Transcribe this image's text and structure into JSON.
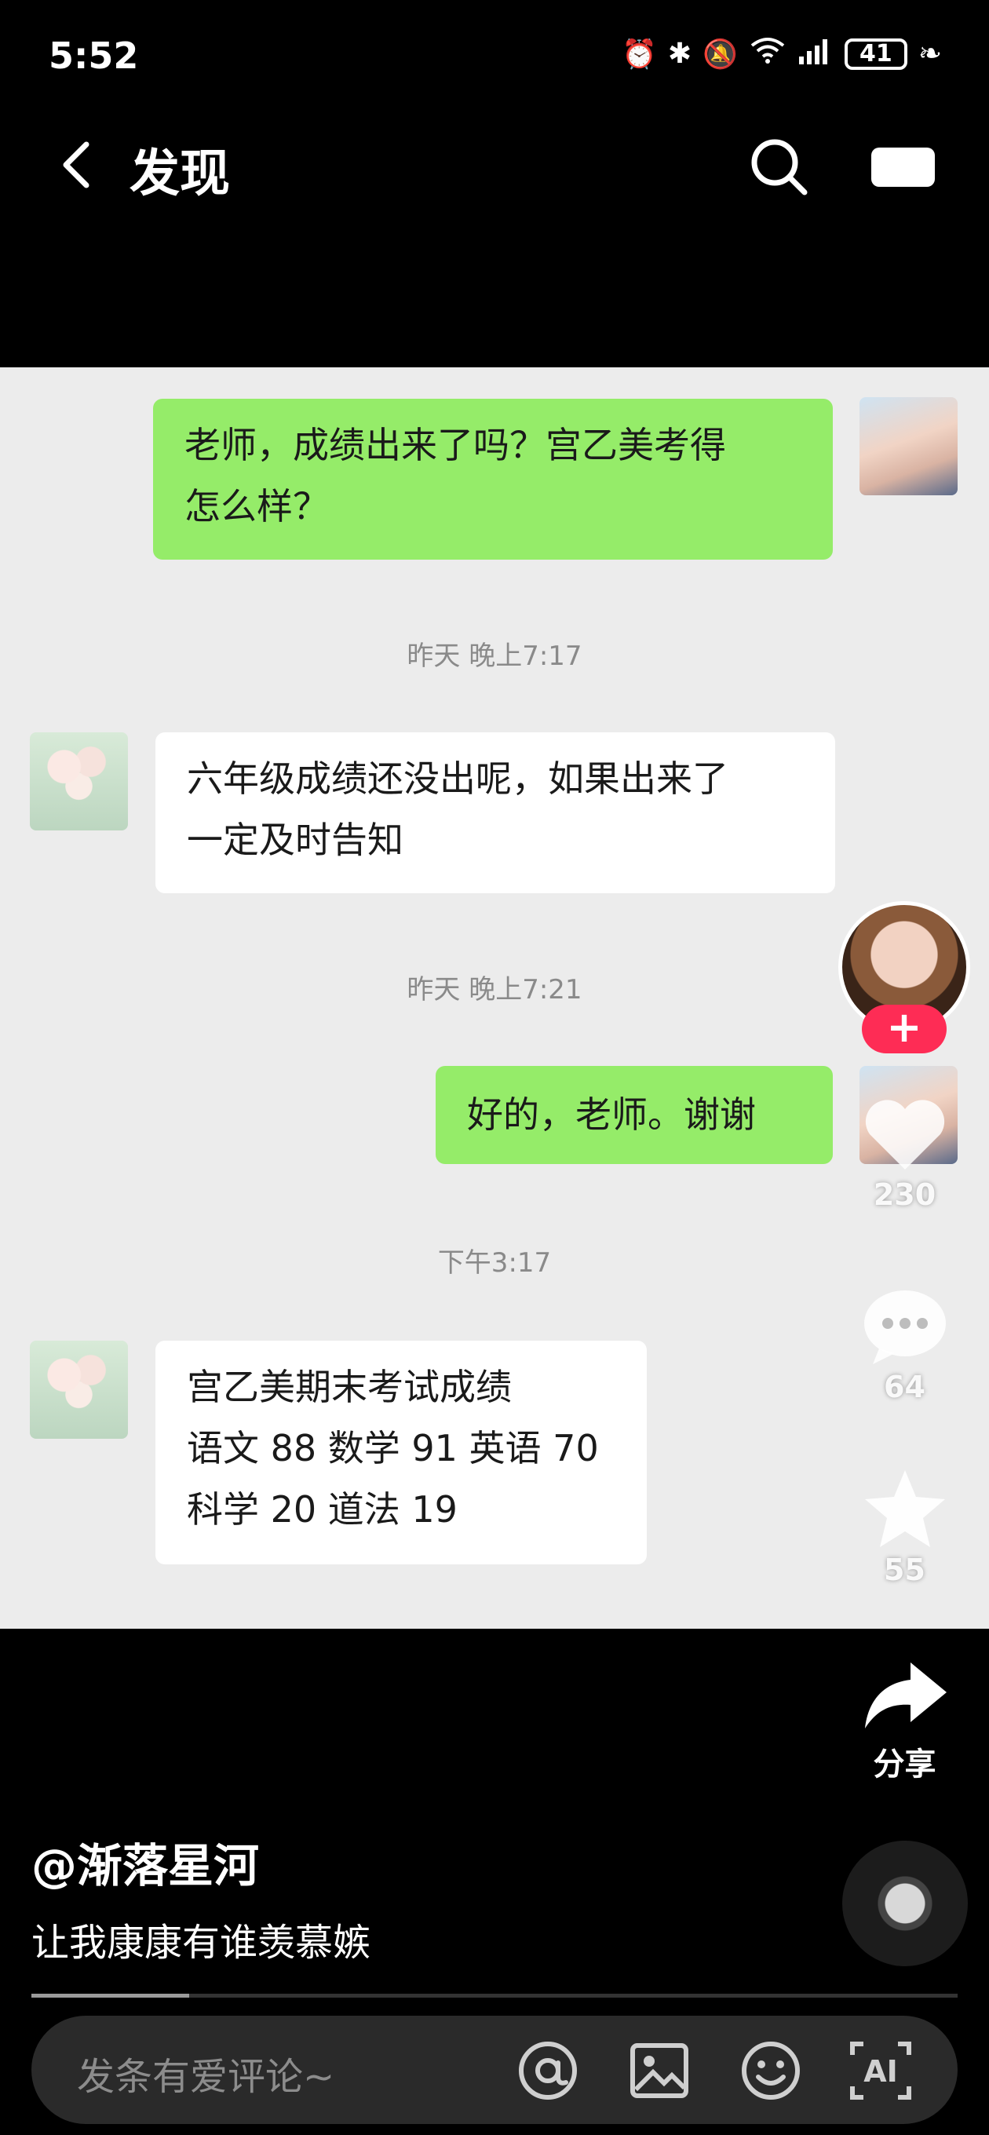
{
  "status_bar": {
    "time": "5:52",
    "battery": "41"
  },
  "nav": {
    "title": "发现"
  },
  "chat": {
    "messages": [
      {
        "side": "right",
        "text": "老师，成绩出来了吗？宫乙美考得\n怎么样？"
      },
      {
        "side": "left",
        "text": "六年级成绩还没出呢，如果出来了\n一定及时告知"
      },
      {
        "side": "right",
        "text": "好的，老师。谢谢"
      },
      {
        "side": "left",
        "text": "宫乙美期末考试成绩\n语文 88 数学 91 英语 70\n科学 20 道法 19"
      }
    ],
    "timestamps": [
      "昨天 晚上7:17",
      "昨天 晚上7:21",
      "下午3:17"
    ]
  },
  "actions": {
    "follow": "+",
    "likes": "230",
    "comments": "64",
    "favorites": "55",
    "share": "分享"
  },
  "video": {
    "author": "@渐落星河",
    "caption": "让我康康有谁羡慕嫉",
    "progress": 0.17
  },
  "comment_bar": {
    "placeholder": "发条有爱评论~"
  },
  "icons": [
    "back-arrow-icon",
    "search-icon",
    "camera-icon",
    "heart-icon",
    "comment-icon",
    "star-icon",
    "share-icon",
    "at-icon",
    "image-icon",
    "emoji-icon",
    "ai-icon"
  ]
}
